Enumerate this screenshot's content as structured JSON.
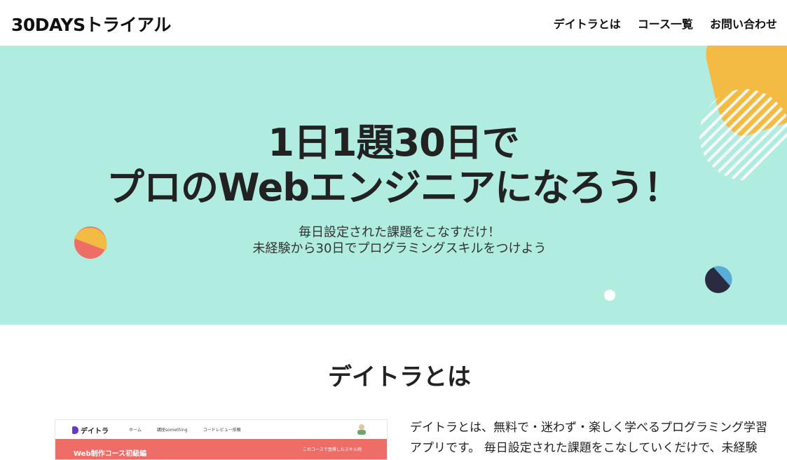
{
  "header": {
    "logo": "30DAYSトライアル",
    "nav": [
      {
        "label": "デイトラとは"
      },
      {
        "label": "コース一覧"
      },
      {
        "label": "お問い合わせ"
      }
    ]
  },
  "hero": {
    "title_line1": "1日1題30日で",
    "title_line2": "プロのWebエンジニアになろう！",
    "subtitle_line1": "毎日設定された課題をこなすだけ！",
    "subtitle_line2": "未経験から30日でプログラミングスキルをつけよう",
    "colors": {
      "background": "#b0ede0",
      "yellow": "#f4bb44",
      "coral": "#ee6d66",
      "navy": "#2a2a40",
      "blue": "#5aaed6",
      "white": "#ffffff"
    }
  },
  "about": {
    "title": "デイトラとは",
    "text_line1": "デイトラとは、無料で・迷わず・楽しく学べるプログラミング学習",
    "text_line2": "アプリです。 毎日設定された課題をこなしていくだけで、未経験"
  },
  "screenshot": {
    "logo": "デイトラ",
    "nav": [
      "ホーム",
      "講座something",
      "コードレビュー依頼"
    ],
    "banner_title": "Web制作コース初級編",
    "banner_note": "このコースで習得したスキル例"
  }
}
